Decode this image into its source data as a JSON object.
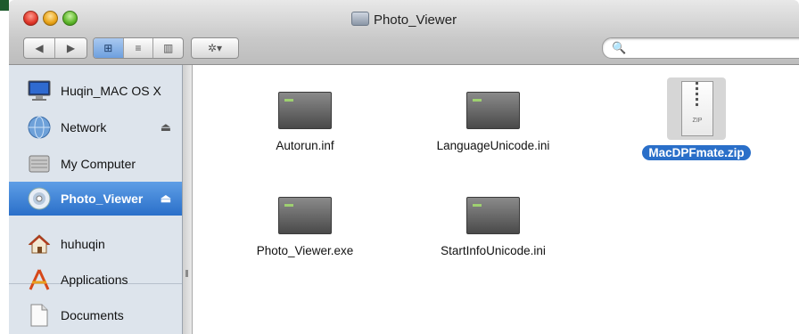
{
  "window": {
    "title": "Photo_Viewer"
  },
  "toolbar": {
    "back_label": "◀",
    "forward_label": "▶",
    "view_icon": "⊞",
    "view_list": "≡",
    "view_columns": "▥",
    "action_label": "✲▾"
  },
  "search": {
    "icon": "🔍",
    "placeholder": ""
  },
  "sidebar": {
    "items": [
      {
        "label": "Huqin_MAC OS X",
        "icon": "computer-icon"
      },
      {
        "label": "Network",
        "icon": "network-globe-icon",
        "eject": "⏏"
      },
      {
        "label": "My Computer",
        "icon": "drive-icon"
      },
      {
        "label": "Photo_Viewer",
        "icon": "cd-disc-icon",
        "eject": "⏏",
        "selected": true
      },
      {
        "label": "huhuqin",
        "icon": "home-icon"
      },
      {
        "label": "Applications",
        "icon": "applications-icon"
      },
      {
        "label": "Documents",
        "icon": "documents-icon"
      }
    ]
  },
  "files": [
    {
      "name": "Autorun.inf",
      "type": "document"
    },
    {
      "name": "LanguageUnicode.ini",
      "type": "document"
    },
    {
      "name": "MacDPFmate.zip",
      "type": "zip",
      "selected": true,
      "badge": "ZIP"
    },
    {
      "name": "Photo_Viewer.exe",
      "type": "document"
    },
    {
      "name": "StartInfoUnicode.ini",
      "type": "document"
    }
  ],
  "colors": {
    "selection": "#2a6fc9",
    "sidebar_bg": "#dde4ec"
  }
}
